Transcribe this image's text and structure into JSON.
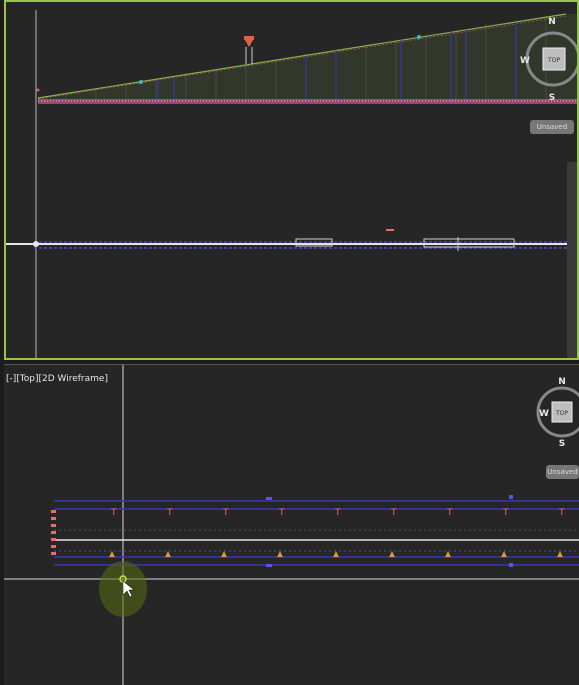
{
  "viewports": {
    "top": {
      "unsaved_label": "Unsaved",
      "compass": {
        "north": "N",
        "south": "S",
        "west": "W",
        "center": "TOP"
      }
    },
    "bottom": {
      "label": "[-][Top][2D Wireframe]",
      "unsaved_label": "Unsaved",
      "compass": {
        "north": "N",
        "south": "S",
        "west": "W",
        "center": "TOP"
      }
    }
  },
  "colors": {
    "accent_border": "#9bc44b",
    "background": "#262626",
    "profile_line": "#6a8f3a",
    "alignment_blue": "#3b34b8",
    "marker_red": "#e0604a",
    "crosshair": "#d6d6d6"
  }
}
